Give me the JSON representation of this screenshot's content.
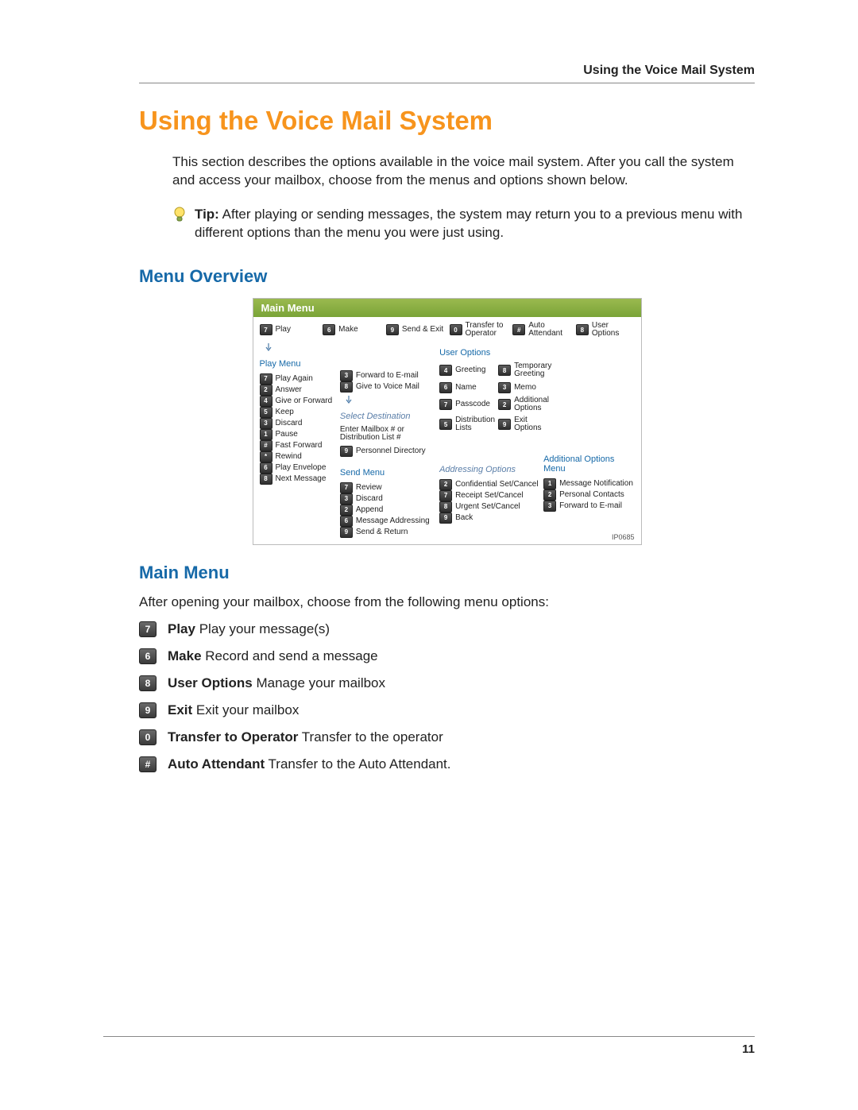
{
  "header": {
    "running": "Using the Voice Mail System"
  },
  "title": "Using the Voice Mail System",
  "intro": "This section describes the options available in the voice mail system. After you call the system and access your mailbox, choose from the menus and options shown below.",
  "tip": {
    "label": "Tip:",
    "text": " After playing or sending messages, the system may return you to a previous menu with different options than the menu you were just using."
  },
  "h2_overview": "Menu Overview",
  "h2_main": "Main Menu",
  "main_menu_intro": "After opening your mailbox, choose from the following menu options:",
  "main_menu": [
    {
      "key": "7",
      "label": "Play",
      "desc": "Play your message(s)"
    },
    {
      "key": "6",
      "label": "Make",
      "desc": "Record and send a message"
    },
    {
      "key": "8",
      "label": "User Options",
      "desc": "Manage your mailbox"
    },
    {
      "key": "9",
      "label": "Exit",
      "desc": "Exit your mailbox"
    },
    {
      "key": "0",
      "label": "Transfer to Operator",
      "desc": "Transfer to the operator"
    },
    {
      "key": "#",
      "label": "Auto Attendant",
      "desc": "Transfer to the Auto Attendant."
    }
  ],
  "diagram": {
    "title": "Main Menu",
    "id": "IP0685",
    "top_row": [
      {
        "k": "7",
        "t": "Play"
      },
      {
        "k": "6",
        "t": "Make"
      },
      {
        "k": "9",
        "t": "Send & Exit"
      },
      {
        "k": "0",
        "t": "Transfer to Operator"
      },
      {
        "k": "#",
        "t": "Auto Attendant"
      },
      {
        "k": "8",
        "t": "User Options"
      }
    ],
    "play_menu": {
      "title": "Play Menu",
      "items": [
        {
          "k": "7",
          "t": "Play Again"
        },
        {
          "k": "2",
          "t": "Answer"
        },
        {
          "k": "4",
          "t": "Give or Forward"
        },
        {
          "k": "5",
          "t": "Keep"
        },
        {
          "k": "3",
          "t": "Discard"
        },
        {
          "k": "1",
          "t": "Pause"
        },
        {
          "k": "#",
          "t": "Fast Forward"
        },
        {
          "k": "*",
          "t": "Rewind"
        },
        {
          "k": "6",
          "t": "Play Envelope"
        },
        {
          "k": "8",
          "t": "Next Message"
        }
      ]
    },
    "forward_sub": [
      {
        "k": "3",
        "t": "Forward to E-mail"
      },
      {
        "k": "8",
        "t": "Give to Voice Mail"
      }
    ],
    "select_dest": {
      "title": "Select Destination",
      "sub": "Enter Mailbox # or Distribution List #",
      "items": [
        {
          "k": "9",
          "t": "Personnel Directory"
        }
      ]
    },
    "send_menu": {
      "title": "Send Menu",
      "items": [
        {
          "k": "7",
          "t": "Review"
        },
        {
          "k": "3",
          "t": "Discard"
        },
        {
          "k": "2",
          "t": "Append"
        },
        {
          "k": "6",
          "t": "Message Addressing"
        },
        {
          "k": "9",
          "t": "Send & Return"
        }
      ]
    },
    "addressing": {
      "title": "Addressing Options",
      "items": [
        {
          "k": "2",
          "t": "Confidential Set/Cancel"
        },
        {
          "k": "7",
          "t": "Receipt Set/Cancel"
        },
        {
          "k": "8",
          "t": "Urgent Set/Cancel"
        },
        {
          "k": "9",
          "t": "Back"
        }
      ]
    },
    "user_options": {
      "title": "User Options",
      "items": [
        {
          "k": "4",
          "t": "Greeting"
        },
        {
          "k": "8",
          "t": "Temporary Greeting"
        },
        {
          "k": "6",
          "t": "Name"
        },
        {
          "k": "3",
          "t": "Memo"
        },
        {
          "k": "7",
          "t": "Passcode"
        },
        {
          "k": "2",
          "t": "Additional Options"
        },
        {
          "k": "5",
          "t": "Distribution Lists"
        },
        {
          "k": "9",
          "t": "Exit Options"
        }
      ]
    },
    "additional": {
      "title": "Additional Options Menu",
      "items": [
        {
          "k": "1",
          "t": "Message Notification"
        },
        {
          "k": "2",
          "t": "Personal Contacts"
        },
        {
          "k": "3",
          "t": "Forward to E-mail"
        }
      ]
    }
  },
  "page_number": "11"
}
